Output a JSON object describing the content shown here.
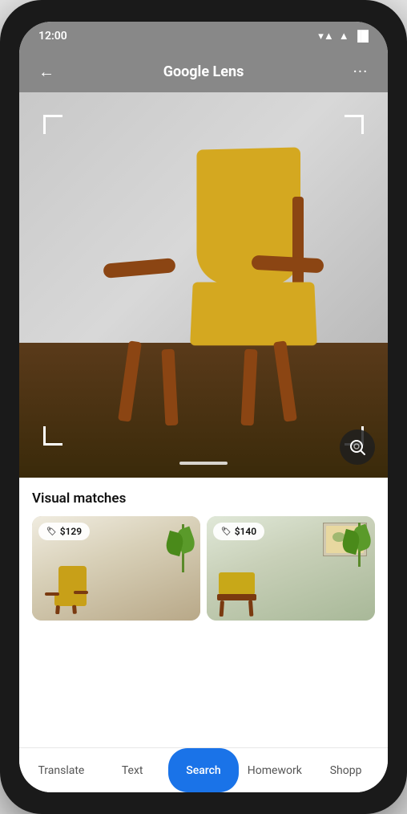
{
  "device": {
    "time": "12:00"
  },
  "app_bar": {
    "title_part1": "Google",
    "title_part2": "Lens",
    "back_label": "←",
    "more_label": "···"
  },
  "camera": {
    "scroll_handle_aria": "drag handle"
  },
  "results": {
    "section_title": "Visual matches",
    "cards": [
      {
        "price": "$129"
      },
      {
        "price": "$140"
      }
    ]
  },
  "nav_tabs": [
    {
      "label": "Translate",
      "active": false
    },
    {
      "label": "Text",
      "active": false
    },
    {
      "label": "Search",
      "active": true
    },
    {
      "label": "Homework",
      "active": false
    },
    {
      "label": "Shopp",
      "active": false
    }
  ],
  "colors": {
    "active_tab_bg": "#1a73e8",
    "chair_yellow": "#d4a820",
    "wood_brown": "#8B4513"
  }
}
